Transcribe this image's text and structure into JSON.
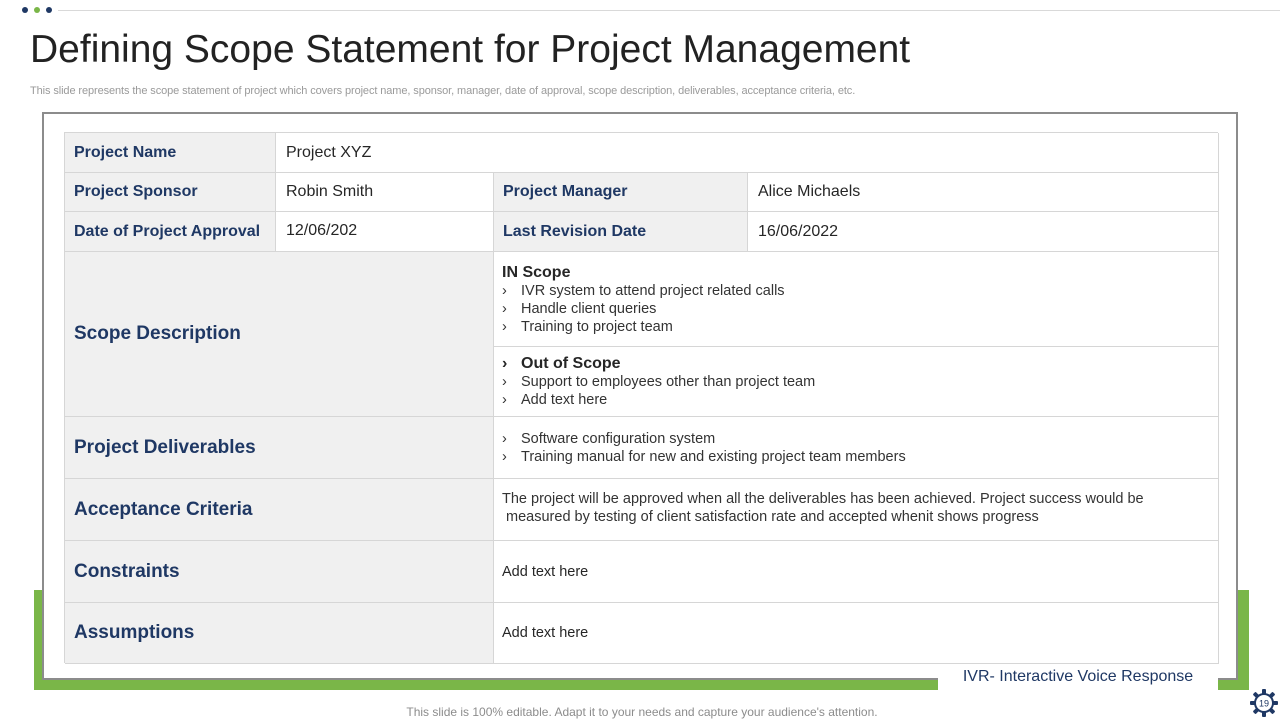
{
  "header": {
    "title": "Defining Scope Statement for Project Management",
    "subtitle": "This slide represents the scope statement of project which covers project name, sponsor, manager, date of approval, scope description, deliverables, acceptance criteria, etc."
  },
  "table": {
    "project_name": {
      "label": "Project Name",
      "value": "Project XYZ"
    },
    "project_sponsor": {
      "label": "Project Sponsor",
      "value": "Robin Smith"
    },
    "project_manager": {
      "label": "Project Manager",
      "value": "Alice Michaels"
    },
    "approval_date": {
      "label": "Date of Project Approval",
      "value": "12/06/202"
    },
    "revision_date": {
      "label": "Last Revision Date",
      "value": "16/06/2022"
    },
    "scope_description": {
      "label": "Scope Description",
      "in_scope": {
        "heading": "IN Scope",
        "items": [
          "IVR system to attend project related calls",
          "Handle client queries",
          "Training to project team"
        ]
      },
      "out_scope": {
        "heading": "Out of Scope",
        "items": [
          "Support to employees other than project team",
          "Add text here"
        ]
      }
    },
    "deliverables": {
      "label": "Project Deliverables",
      "items": [
        "Software configuration system",
        "Training manual for new and existing project team members"
      ]
    },
    "acceptance": {
      "label": "Acceptance Criteria",
      "line1": "The project will be approved when all the deliverables has been achieved. Project success would be",
      "line2": " measured by testing of client satisfaction rate and accepted whenit shows progress"
    },
    "constraints": {
      "label": "Constraints",
      "value": "Add text here"
    },
    "assumptions": {
      "label": "Assumptions",
      "value": "Add text here"
    }
  },
  "chevron": "›",
  "ivr_note": "IVR- Interactive  Voice Response",
  "footer": "This slide is 100% editable. Adapt it to your needs and capture your audience's attention.",
  "page_number": "19",
  "colors": {
    "navy": "#1f3864",
    "green": "#7ab648",
    "label_bg": "#f0f0f0"
  }
}
